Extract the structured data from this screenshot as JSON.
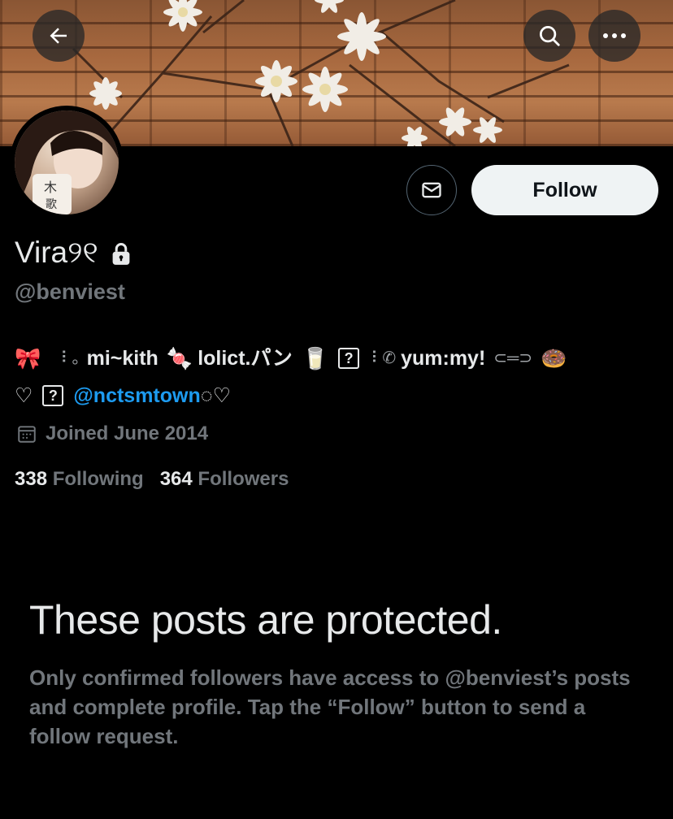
{
  "header": {
    "back_icon": "arrow-left-icon",
    "search_icon": "search-icon",
    "more_icon": "more-horizontal-icon"
  },
  "profile": {
    "display_name": "Vira୨୧",
    "handle": "@benviest",
    "protected_icon": "lock-icon",
    "message_icon": "envelope-icon",
    "follow_label": "Follow",
    "bio": {
      "line1": {
        "emoji_ribbon": "🎀",
        "dots1": "⠸ ｡",
        "text1": "mi~kith",
        "emoji_candy": "🍬",
        "text2": "lolict.パン",
        "emoji_milk": "🥛",
        "qbox1": "?",
        "dots2": "⠸ ✆",
        "text3": "yum:my!",
        "emoji_hairpin": "⊂═⊃",
        "emoji_donut": "🍩"
      },
      "line2": {
        "heart1": "♡",
        "qbox2": "?",
        "mention": "@nctsmtown",
        "tail": "◌♡"
      }
    },
    "joined": "Joined June 2014",
    "calendar_icon": "calendar-icon",
    "following_count": "338",
    "following_label": "Following",
    "followers_count": "364",
    "followers_label": "Followers"
  },
  "protected": {
    "title": "These posts are protected.",
    "description": "Only confirmed followers have access to @benviest’s posts and complete profile. Tap the “Follow” button to send a follow request."
  },
  "colors": {
    "background": "#000000",
    "text_primary": "#e7e9ea",
    "text_secondary": "#71767b",
    "link": "#1d9bf0",
    "follow_button": "#eff3f4"
  }
}
